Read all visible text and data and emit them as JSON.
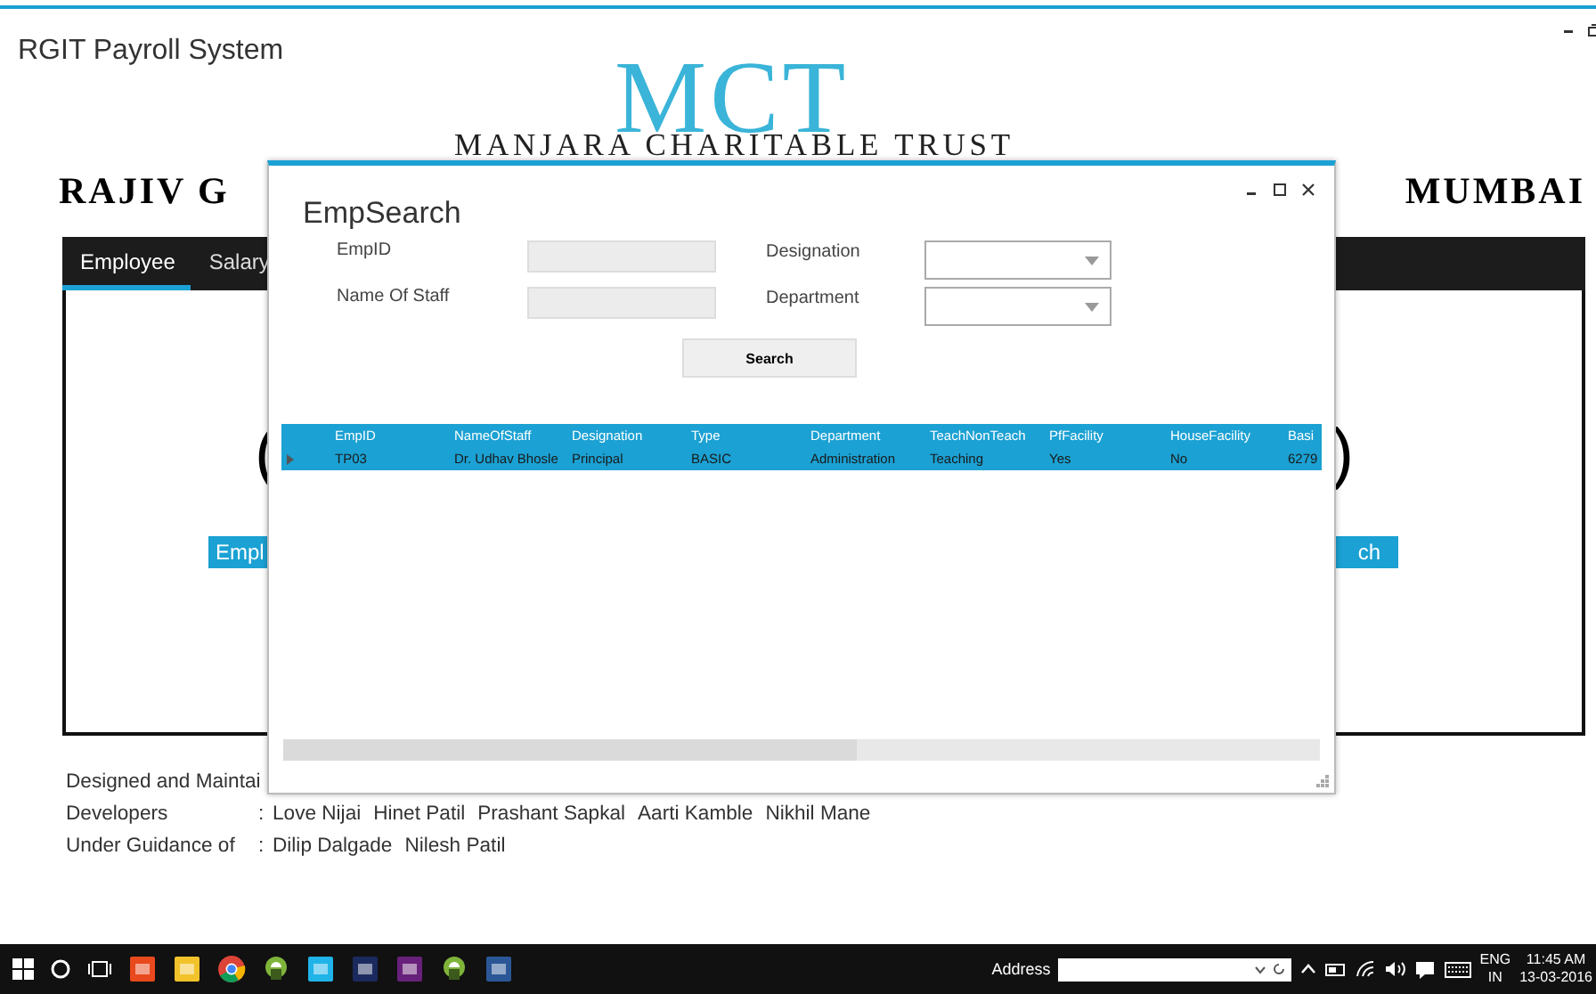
{
  "window": {
    "title": "RGIT Payroll System"
  },
  "header": {
    "logo": "MCT",
    "trust": "MANJARA CHARITABLE TRUST",
    "college_left": "RAJIV G",
    "college_right": "MUMBAI"
  },
  "tabs": [
    {
      "label": "Employee",
      "selected": true
    },
    {
      "label": "Salary",
      "selected": false
    }
  ],
  "panel": {
    "bracket_left": "(",
    "bracket_right": ")",
    "button_left": "Empl",
    "button_right": "ch"
  },
  "credits": [
    {
      "label": "Designed and Maintai"
    },
    {
      "label": "Developers",
      "separator": ":",
      "names": [
        "Love Nijai",
        "Hinet Patil",
        "Prashant Sapkal",
        "Aarti Kamble",
        "Nikhil Mane"
      ]
    },
    {
      "label": "Under Guidance of",
      "separator": ":",
      "names": [
        "Dilip Dalgade",
        "Nilesh Patil"
      ]
    }
  ],
  "dialog": {
    "title": "EmpSearch",
    "fields": [
      {
        "label": "EmpID",
        "kind": "text"
      },
      {
        "label": "Designation",
        "kind": "combo"
      },
      {
        "label": "Name Of Staff",
        "kind": "text"
      },
      {
        "label": "Department",
        "kind": "combo"
      }
    ],
    "search_button": "Search",
    "grid": {
      "columns": [
        "EmpID",
        "NameOfStaff",
        "Designation",
        "Type",
        "Department",
        "TeachNonTeach",
        "PfFacility",
        "HouseFacility",
        "Basi"
      ],
      "rows": [
        {
          "selected": true,
          "cells": [
            "TP03",
            "Dr. Udhav Bhosle",
            "Principal",
            "BASIC",
            "Administration",
            "Teaching",
            "Yes",
            "No",
            "6279"
          ]
        }
      ]
    }
  },
  "taskbar": {
    "address_label": "Address",
    "language": [
      "ENG",
      "IN"
    ],
    "time": "11:45 AM",
    "date": "13-03-2016"
  }
}
